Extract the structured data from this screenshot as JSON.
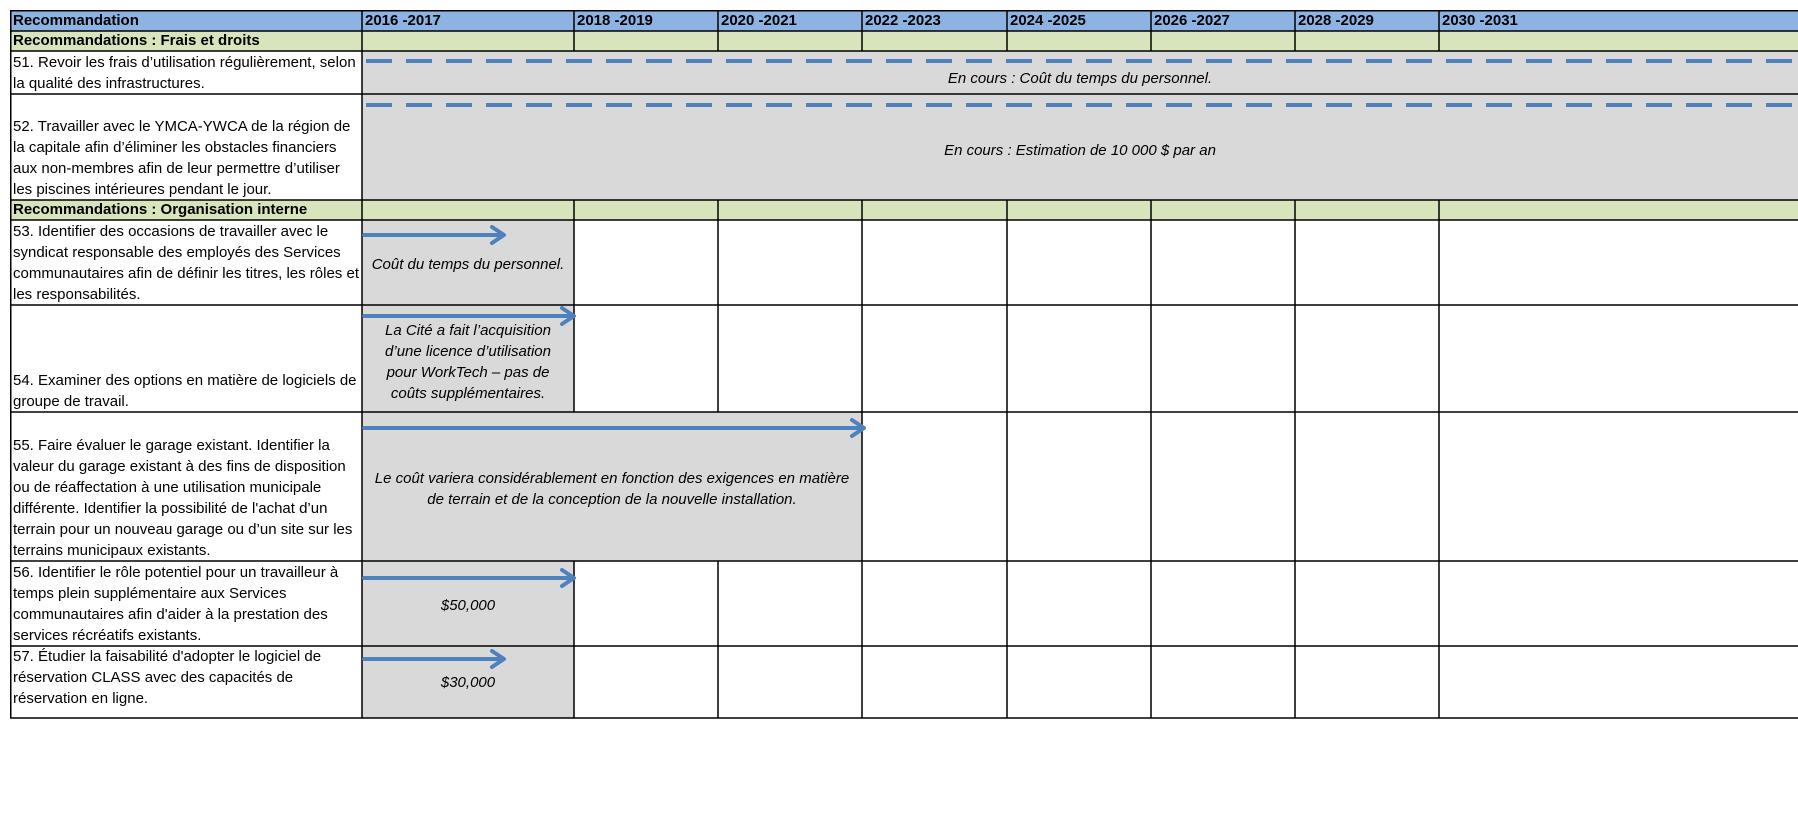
{
  "header": {
    "recommendation": "Recommandation",
    "periods": [
      "2016 -2017",
      "2018 -2019",
      "2020 -2021",
      "2022 -2023",
      "2024 -2025",
      "2026 -2027",
      "2028 -2029",
      "2030 -2031"
    ]
  },
  "sections": {
    "fees": "Recommandations : Frais et droits",
    "org": "Recommandations : Organisation interne"
  },
  "rows": [
    {
      "text": "51. Revoir les frais d’utilisation régulièrement, selon la qualité des infrastructures.",
      "note": "En cours : Coût du temps du personnel."
    },
    {
      "text": "52. Travailler avec le YMCA-YWCA de la région de la capitale afin d’éliminer les obstacles financiers aux non-membres afin de leur permettre d’utiliser les piscines intérieures pendant le jour.",
      "note": "En cours : Estimation de 10 000 $ par an"
    },
    {
      "text": "53. Identifier des occasions de travailler avec le syndicat responsable des employés des Services communautaires afin de définir les titres, les rôles et les responsabilités.",
      "note": "Coût du temps du personnel."
    },
    {
      "text": "54. Examiner des options en matière de logiciels de groupe de travail.",
      "note": "La Cité a fait l’acquisition d’une licence d’utilisation pour WorkTech – pas de coûts supplémentaires."
    },
    {
      "text": "55. Faire évaluer le garage existant. Identifier la valeur du garage existant à des fins de disposition ou de réaffectation à une utilisation municipale différente. Identifier la possibilité de l'achat d’un terrain pour un nouveau garage ou d’un site sur les terrains municipaux existants.",
      "note": "Le coût variera considérablement en fonction des exigences en matière de terrain et de la conception de la nouvelle installation."
    },
    {
      "text": "56. Identifier le rôle potentiel pour un travailleur à temps plein supplémentaire aux Services communautaires afin d'aider à la prestation des services récréatifs existants.",
      "note": "$50,000"
    },
    {
      "text": "57. Étudier la faisabilité d'adopter le logiciel de réservation CLASS avec des capacités de réservation en ligne.",
      "note": "$30,000"
    }
  ],
  "colors": {
    "header_bg": "#8db3e2",
    "section_bg": "#d7e4bc",
    "shade": "#d9d9d9",
    "arrow": "#4f81bd"
  }
}
